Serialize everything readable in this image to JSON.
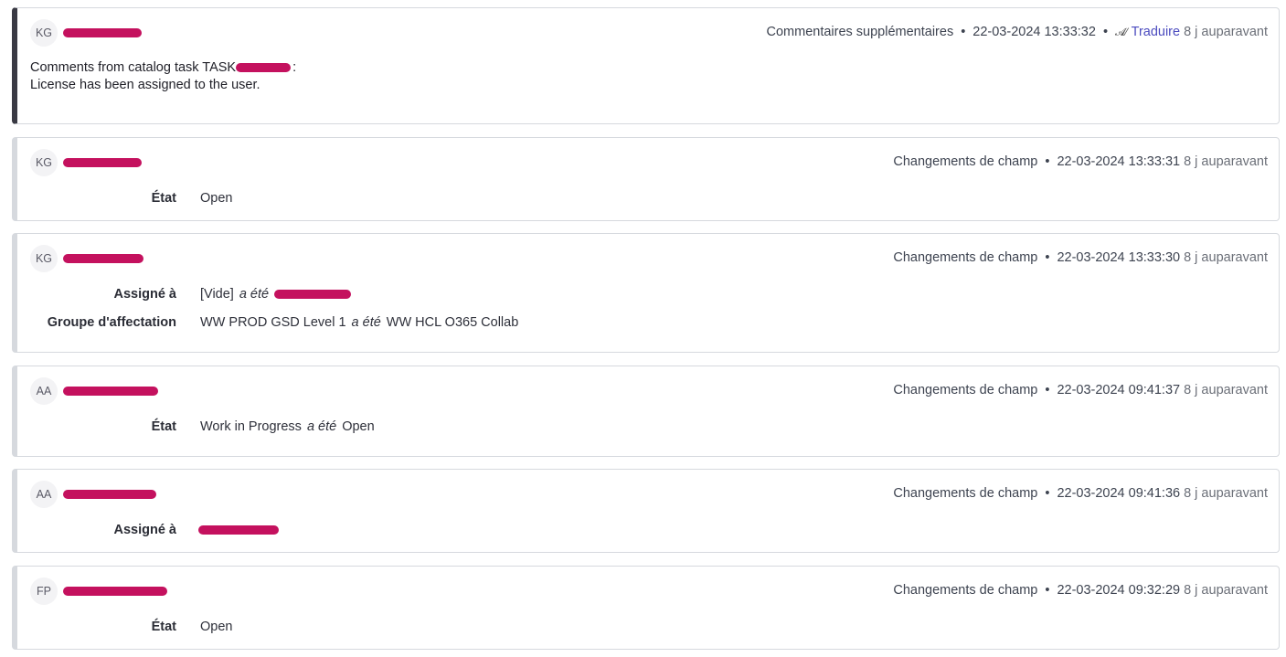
{
  "common": {
    "ago": "8 j auparavant",
    "changed_to": "a été",
    "field_changes": "Changements de champ"
  },
  "entries": [
    {
      "initials": "KG",
      "type": "Commentaires supplémentaires",
      "timestamp": "22-03-2024 13:33:32",
      "translate": "Traduire",
      "comment_line1": "Comments from catalog task TASK",
      "comment_line1_suffix": ":",
      "comment_line2": "License has been assigned to the user."
    },
    {
      "initials": "KG",
      "timestamp": "22-03-2024 13:33:31",
      "fields": [
        {
          "label": "État",
          "value": "Open"
        }
      ]
    },
    {
      "initials": "KG",
      "timestamp": "22-03-2024 13:33:30",
      "fields": [
        {
          "label": "Assigné à",
          "old": "[Vide]"
        },
        {
          "label": "Groupe d'affectation",
          "old": "WW PROD GSD Level 1",
          "new": "WW HCL O365 Collab"
        }
      ]
    },
    {
      "initials": "AA",
      "timestamp": "22-03-2024 09:41:37",
      "fields": [
        {
          "label": "État",
          "old": "Work in Progress",
          "new": "Open"
        }
      ]
    },
    {
      "initials": "AA",
      "timestamp": "22-03-2024 09:41:36",
      "fields": [
        {
          "label": "Assigné à"
        }
      ]
    },
    {
      "initials": "FP",
      "timestamp": "22-03-2024 09:32:29",
      "fields": [
        {
          "label": "État",
          "value": "Open"
        }
      ]
    }
  ],
  "colors": {
    "redaction": "#c4115e",
    "link": "#4b4bbf",
    "comment_accent": "#3a3a44"
  },
  "icons": {
    "translate": "translate-icon"
  }
}
